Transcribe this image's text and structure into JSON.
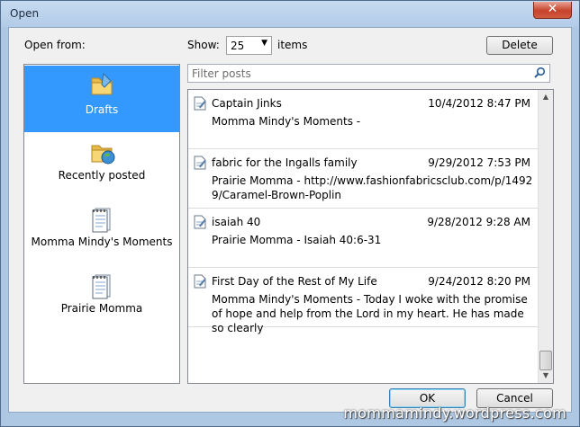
{
  "window": {
    "title": "Open",
    "close_glyph": "✕"
  },
  "left": {
    "open_from_label": "Open from:",
    "items": [
      {
        "label": "Drafts",
        "icon": "drafts-folder-icon",
        "selected": true
      },
      {
        "label": "Recently posted",
        "icon": "globe-folder-icon",
        "selected": false
      },
      {
        "label": "Momma Mindy's Moments",
        "icon": "notebook-icon",
        "selected": false
      },
      {
        "label": "Prairie Momma",
        "icon": "notebook-icon",
        "selected": false
      }
    ]
  },
  "toolbar": {
    "show_label": "Show:",
    "show_value": "25",
    "items_label": "items",
    "delete_label": "Delete"
  },
  "filter": {
    "placeholder": "Filter posts"
  },
  "posts": [
    {
      "title": "Captain Jinks",
      "date": "10/4/2012 8:47 PM",
      "desc": "Momma Mindy's Moments -"
    },
    {
      "title": "fabric for the Ingalls family",
      "date": "9/29/2012 7:53 PM",
      "desc": "Prairie Momma - http://www.fashionfabricsclub.com/p/14929/Caramel-Brown-Poplin"
    },
    {
      "title": "isaiah 40",
      "date": "9/28/2012 9:28 AM",
      "desc": "Prairie Momma - Isaiah 40:6-31"
    },
    {
      "title": "First Day of the Rest of My Life",
      "date": "9/24/2012 8:20 PM",
      "desc": "Momma Mindy's Moments - Today I woke with the promise of hope and help from the Lord in my heart.  He has made so clearly"
    }
  ],
  "buttons": {
    "ok": "OK",
    "cancel": "Cancel"
  },
  "watermark": "mommamindy.wordpress.com",
  "colors": {
    "selection": "#3399ff",
    "accent": "#3c7fb1"
  }
}
